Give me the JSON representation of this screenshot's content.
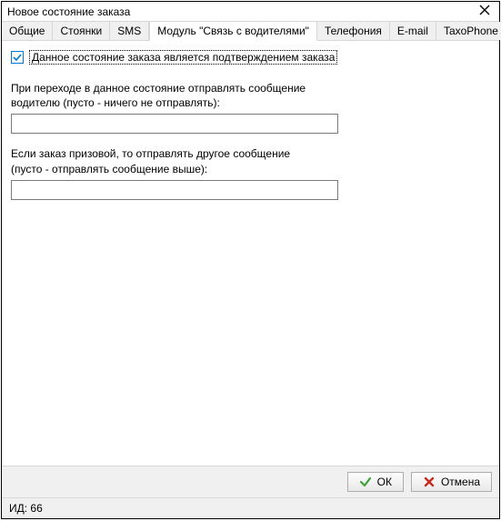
{
  "window": {
    "title": "Новое состояние заказа"
  },
  "tabs": {
    "items": [
      {
        "label": "Общие"
      },
      {
        "label": "Стоянки"
      },
      {
        "label": "SMS"
      },
      {
        "label": "Модуль \"Связь с водителями\""
      },
      {
        "label": "Телефония"
      },
      {
        "label": "E-mail"
      },
      {
        "label": "TaxoPhone"
      }
    ],
    "active_index": 3
  },
  "form": {
    "confirm_checkbox_label": "Данное состояние заказа является подтверждением заказа",
    "confirm_checked": true,
    "msg_label_line1": "При переходе в данное состояние отправлять сообщение",
    "msg_label_line2": "водителю (пусто - ничего не отправлять):",
    "msg_value": "",
    "prize_label_line1": "Если заказ призовой, то отправлять другое сообщение",
    "prize_label_line2": "(пусто - отправлять сообщение выше):",
    "prize_value": ""
  },
  "buttons": {
    "ok": "ОК",
    "cancel": "Отмена"
  },
  "status": {
    "id_label": "ИД: 66"
  },
  "icons": {
    "close": "close-icon",
    "check": "check-icon",
    "ok": "ok-check-icon",
    "cancel": "cancel-x-icon"
  }
}
